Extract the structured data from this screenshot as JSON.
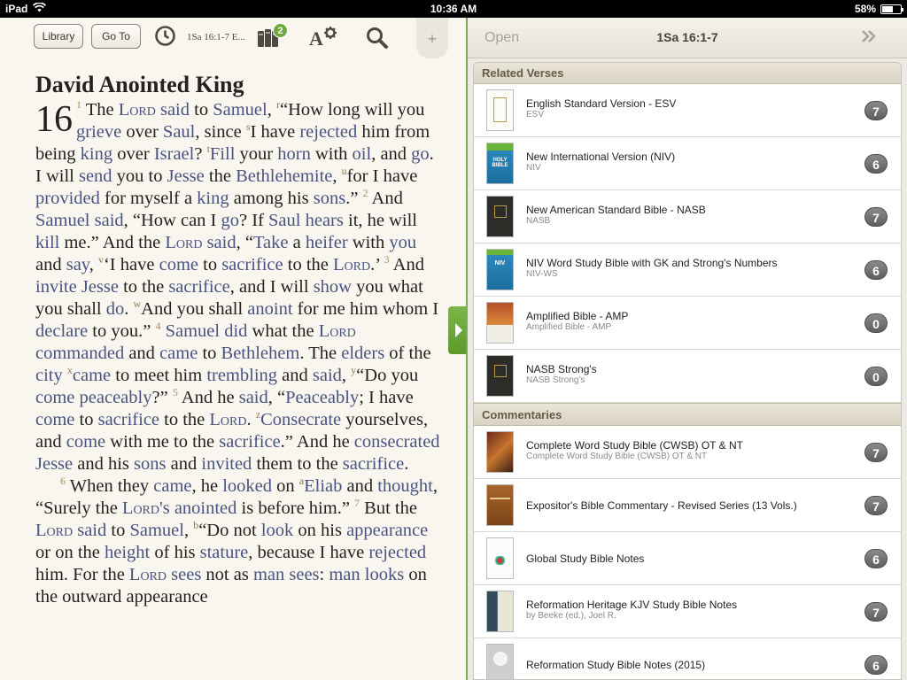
{
  "status_bar": {
    "device": "iPad",
    "time": "10:36 AM",
    "battery": "58%",
    "battery_level": 0.58
  },
  "toolbar": {
    "library_label": "Library",
    "goto_label": "Go To",
    "reference": "1Sa 16:1-7 E...",
    "books_badge": "2",
    "add_tab": "+"
  },
  "reader": {
    "heading": "David Anointed King",
    "chapter": "16"
  },
  "right_panel": {
    "open_label": "Open",
    "title": "1Sa 16:1-7",
    "expand": "»",
    "sections": [
      {
        "title": "Related Verses",
        "items": [
          {
            "title": "English Standard Version - ESV",
            "subtitle": "ESV",
            "count": "7"
          },
          {
            "title": "New International Version (NIV)",
            "subtitle": "NIV",
            "count": "6"
          },
          {
            "title": "New American Standard Bible - NASB",
            "subtitle": "NASB",
            "count": "7"
          },
          {
            "title": "NIV Word Study Bible with GK and Strong's Numbers",
            "subtitle": "NIV-WS",
            "count": "6"
          },
          {
            "title": "Amplified Bible - AMP",
            "subtitle": "Amplified Bible - AMP",
            "count": "0"
          },
          {
            "title": "NASB Strong's",
            "subtitle": "NASB Strong's",
            "count": "0"
          }
        ]
      },
      {
        "title": "Commentaries",
        "items": [
          {
            "title": "Complete Word Study Bible (CWSB) OT & NT",
            "subtitle": "Complete Word Study Bible (CWSB) OT & NT",
            "count": "7"
          },
          {
            "title": "Expositor's Bible Commentary - Revised Series (13 Vols.)",
            "subtitle": "",
            "count": "7"
          },
          {
            "title": "Global Study Bible Notes",
            "subtitle": "",
            "count": "6"
          },
          {
            "title": "Reformation Heritage KJV Study Bible Notes",
            "subtitle": "by Beeke (ed.), Joel R.",
            "count": "7"
          },
          {
            "title": "Reformation Study Bible Notes (2015)",
            "subtitle": "",
            "count": "6"
          }
        ]
      }
    ]
  }
}
